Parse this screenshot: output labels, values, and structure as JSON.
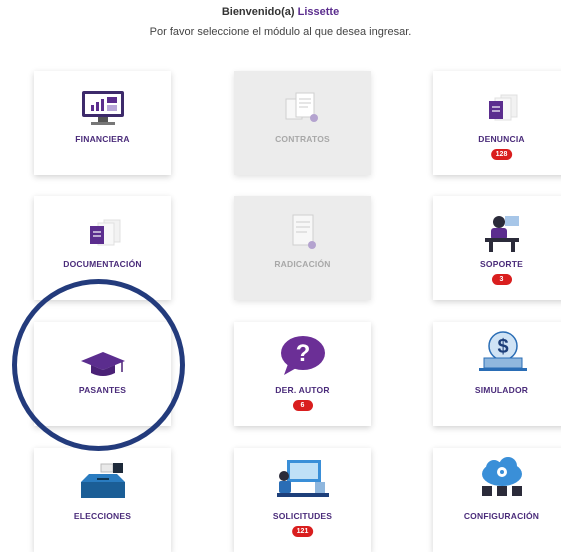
{
  "header": {
    "greeting": "Bienvenido(a)",
    "user_name": "Lissette",
    "subtitle": "Por favor seleccione el módulo al que desea ingresar."
  },
  "modules": [
    {
      "label": "FINANCIERA",
      "icon": "monitor-chart-icon",
      "badge": null,
      "enabled": true
    },
    {
      "label": "CONTRATOS",
      "icon": "documents-icon",
      "badge": null,
      "enabled": false
    },
    {
      "label": "DENUNCIA",
      "icon": "document-stack-icon",
      "badge": "128",
      "enabled": true
    },
    {
      "label": "DOCUMENTACIÓN",
      "icon": "document-stack-icon",
      "badge": null,
      "enabled": true
    },
    {
      "label": "RADICACIÓN",
      "icon": "document-check-icon",
      "badge": null,
      "enabled": false
    },
    {
      "label": "SOPORTE",
      "icon": "support-agent-icon",
      "badge": "3",
      "enabled": true
    },
    {
      "label": "PASANTES",
      "icon": "graduation-cap-icon",
      "badge": null,
      "enabled": true
    },
    {
      "label": "DER. AUTOR",
      "icon": "question-bubble-icon",
      "badge": "6",
      "enabled": true
    },
    {
      "label": "SIMULADOR",
      "icon": "dollar-laptop-icon",
      "badge": null,
      "enabled": true
    },
    {
      "label": "ELECCIONES",
      "icon": "ballot-box-icon",
      "badge": null,
      "enabled": true
    },
    {
      "label": "SOLICITUDES",
      "icon": "request-desk-icon",
      "badge": "121",
      "enabled": true
    },
    {
      "label": "CONFIGURACIÓN",
      "icon": "cloud-settings-icon",
      "badge": null,
      "enabled": true
    }
  ],
  "colors": {
    "label": "#4a2b7a",
    "label_disabled": "#a8a8a8",
    "badge": "#d91e1e",
    "highlight_circle": "#233b7c"
  }
}
